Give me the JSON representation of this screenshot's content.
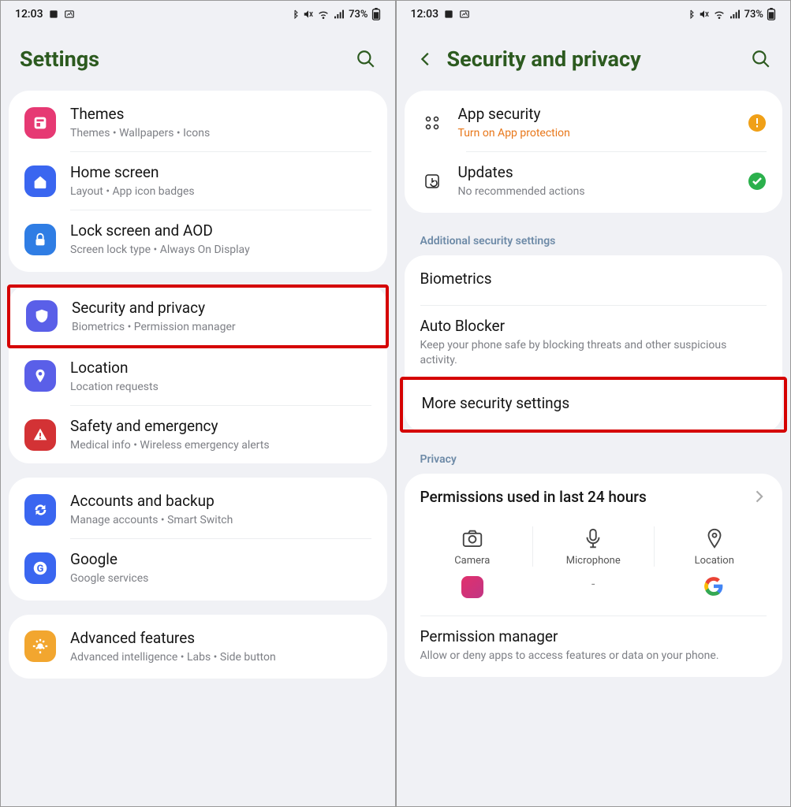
{
  "statusbar": {
    "time": "12:03",
    "battery": "73%"
  },
  "left": {
    "title": "Settings",
    "items": [
      {
        "title": "Themes",
        "sub": "Themes  •  Wallpapers  •  Icons"
      },
      {
        "title": "Home screen",
        "sub": "Layout  •  App icon badges"
      },
      {
        "title": "Lock screen and AOD",
        "sub": "Screen lock type  •  Always On Display"
      },
      {
        "title": "Security and privacy",
        "sub": "Biometrics  •  Permission manager"
      },
      {
        "title": "Location",
        "sub": "Location requests"
      },
      {
        "title": "Safety and emergency",
        "sub": "Medical info  •  Wireless emergency alerts"
      },
      {
        "title": "Accounts and backup",
        "sub": "Manage accounts  •  Smart Switch"
      },
      {
        "title": "Google",
        "sub": "Google services"
      },
      {
        "title": "Advanced features",
        "sub": "Advanced intelligence  •  Labs  •  Side button"
      }
    ]
  },
  "right": {
    "title": "Security and privacy",
    "top": [
      {
        "title": "App security",
        "sub": "Turn on App protection",
        "status": "warning"
      },
      {
        "title": "Updates",
        "sub": "No recommended actions",
        "status": "ok"
      }
    ],
    "section1": "Additional security settings",
    "sec_items": [
      {
        "title": "Biometrics"
      },
      {
        "title": "Auto Blocker",
        "sub": "Keep your phone safe by blocking threats and other suspicious activity."
      },
      {
        "title": "More security settings"
      }
    ],
    "section2": "Privacy",
    "permissions": {
      "header": "Permissions used in last 24 hours",
      "cols": [
        "Camera",
        "Microphone",
        "Location"
      ],
      "apps_mid": "-"
    },
    "perm_mgr": {
      "title": "Permission manager",
      "sub": "Allow or deny apps to access features or data on your phone."
    }
  }
}
